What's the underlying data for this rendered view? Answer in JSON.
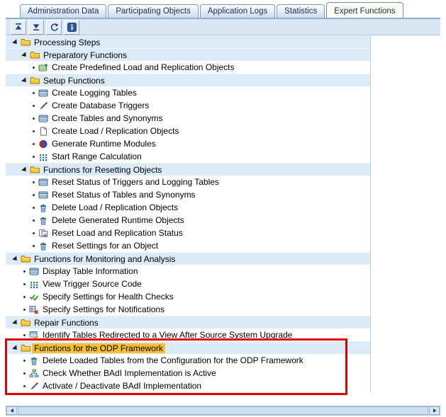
{
  "tabs": [
    {
      "label": "Administration Data",
      "active": false
    },
    {
      "label": "Participating Objects",
      "active": false
    },
    {
      "label": "Application Logs",
      "active": false
    },
    {
      "label": "Statistics",
      "active": false
    },
    {
      "label": "Expert Functions",
      "active": true
    }
  ],
  "toolbar": {
    "buttons": [
      {
        "name": "scroll-to-top-button",
        "icon": "up-arrow"
      },
      {
        "name": "scroll-to-bottom-button",
        "icon": "down-arrow"
      },
      {
        "name": "refresh-button",
        "icon": "refresh"
      },
      {
        "name": "info-button",
        "icon": "info"
      }
    ]
  },
  "tree": {
    "rows": [
      {
        "level": 0,
        "type": "folder",
        "label": "Processing Steps"
      },
      {
        "level": 1,
        "type": "folder",
        "label": "Preparatory Functions"
      },
      {
        "level": 2,
        "type": "item",
        "icon": "table-plus",
        "label": "Create Predefined Load and Replication Objects"
      },
      {
        "level": 1,
        "type": "folder",
        "label": "Setup Functions"
      },
      {
        "level": 2,
        "type": "item",
        "icon": "table",
        "label": "Create Logging Tables"
      },
      {
        "level": 2,
        "type": "item",
        "icon": "pen",
        "label": "Create Database Triggers"
      },
      {
        "level": 2,
        "type": "item",
        "icon": "table",
        "label": "Create Tables and Synonyms"
      },
      {
        "level": 2,
        "type": "item",
        "icon": "document",
        "label": "Create Load / Replication Objects"
      },
      {
        "level": 2,
        "type": "item",
        "icon": "sphere",
        "label": "Generate Runtime Modules"
      },
      {
        "level": 2,
        "type": "item",
        "icon": "dots-grid",
        "label": "Start Range Calculation"
      },
      {
        "level": 1,
        "type": "folder",
        "label": "Functions for Resetting Objects"
      },
      {
        "level": 2,
        "type": "item",
        "icon": "table",
        "label": "Reset Status of Triggers and Logging Tables"
      },
      {
        "level": 2,
        "type": "item",
        "icon": "table",
        "label": "Reset Status of Tables and Synonyms"
      },
      {
        "level": 2,
        "type": "item",
        "icon": "trash",
        "label": "Delete Load / Replication Objects"
      },
      {
        "level": 2,
        "type": "item",
        "icon": "trash",
        "label": "Delete Generated Runtime Objects"
      },
      {
        "level": 2,
        "type": "item",
        "icon": "status-arrows",
        "label": "Reset Load and Replication Status"
      },
      {
        "level": 2,
        "type": "item",
        "icon": "trash",
        "label": "Reset Settings for an Object"
      },
      {
        "level": 0,
        "type": "folder",
        "label": "Functions for Monitoring and Analysis"
      },
      {
        "level": 1,
        "type": "item",
        "icon": "table",
        "label": "Display Table Information"
      },
      {
        "level": 1,
        "type": "item",
        "icon": "dots-grid",
        "label": "View Trigger Source Code"
      },
      {
        "level": 1,
        "type": "item",
        "icon": "double-check",
        "label": "Specify Settings for Health Checks"
      },
      {
        "level": 1,
        "type": "item",
        "icon": "grid-red-x",
        "label": "Specify Settings for Notifications"
      },
      {
        "level": 0,
        "type": "folder",
        "label": "Repair Functions"
      },
      {
        "level": 1,
        "type": "item",
        "icon": "table-arrow",
        "label": "Identify Tables Redirected to a View After Source System Upgrade"
      },
      {
        "level": 0,
        "type": "folder",
        "label": "Functions for the ODP Framework",
        "highlight": true,
        "redbox": true
      },
      {
        "level": 1,
        "type": "item",
        "icon": "trash",
        "label": "Delete Loaded Tables from the Configuration for the ODP Framework",
        "redbox": true
      },
      {
        "level": 1,
        "type": "item",
        "icon": "org-chart",
        "label": "Check Whether BAdI Implementation is Active",
        "redbox": true
      },
      {
        "level": 1,
        "type": "item",
        "icon": "pen",
        "label": "Activate / Deactivate BAdI Implementation",
        "redbox": true
      }
    ]
  },
  "colors": {
    "folder_row_bg": "#dcebf8",
    "folder_icon": "#fac832",
    "highlight_bg": "#f5c02e",
    "red_box": "#e00000"
  }
}
